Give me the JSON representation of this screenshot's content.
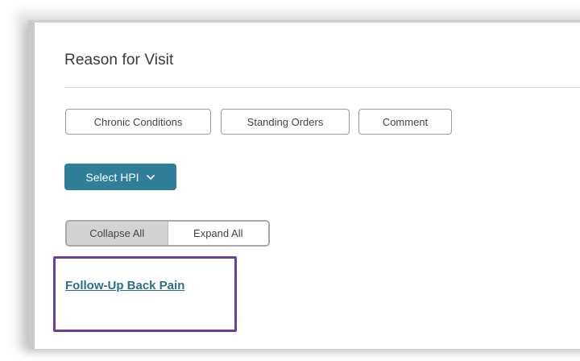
{
  "section": {
    "title": "Reason for Visit"
  },
  "buttons": {
    "chronic_conditions": "Chronic Conditions",
    "standing_orders": "Standing Orders",
    "comment": "Comment"
  },
  "select_hpi": {
    "label": "Select HPI",
    "icon": "chevron-down-icon"
  },
  "toggle": {
    "collapse_all": "Collapse All",
    "expand_all": "Expand All",
    "selected": "Collapse All"
  },
  "hpi_items": [
    {
      "label": "Follow-Up Back Pain"
    }
  ],
  "colors": {
    "primary": "#2f7f98",
    "link": "#2a6f87",
    "highlight_box": "#6b3fa0",
    "segment_selected": "#d3d3d3"
  }
}
